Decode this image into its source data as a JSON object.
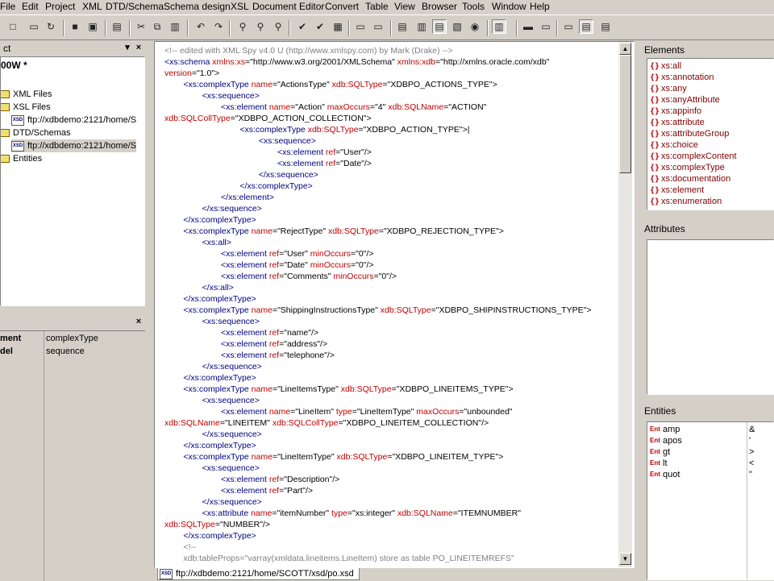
{
  "menu": [
    "File",
    "Edit",
    "Project",
    "XML",
    "DTD/Schema",
    "Schema design",
    "XSL",
    "Document Editor",
    "Convert",
    "Table",
    "View",
    "Browser",
    "Tools",
    "Window",
    "Help"
  ],
  "project_pane": {
    "title": "ct",
    "root": "00W *",
    "items": [
      {
        "label": "XML Files",
        "icon": "folder-icon"
      },
      {
        "label": "XSL Files",
        "icon": "folder-icon"
      },
      {
        "label": "ftp://xdbdemo:2121/home/S",
        "icon": "xsd-file-icon"
      },
      {
        "label": "DTD/Schemas",
        "icon": "folder-icon"
      },
      {
        "label": "ftp://xdbdemo:2121/home/S",
        "icon": "xsd-file-icon"
      },
      {
        "label": "Entities",
        "icon": "folder-icon"
      }
    ]
  },
  "info_pane": {
    "rows": [
      {
        "key": "ment",
        "value": "complexType"
      },
      {
        "key": "del",
        "value": "sequence"
      }
    ]
  },
  "editor": {
    "lines": [
      [
        [
          "cmt",
          "<!-- edited with XML Spy v4.0 U (http://www.xmlspy.com) by Mark (Drake) -->"
        ]
      ],
      [
        [
          "tag",
          "<xs:schema "
        ],
        [
          "att",
          "xmlns:xs"
        ],
        [
          "val",
          "=\"http://www.w3.org/2001/XMLSchema\" "
        ],
        [
          "att",
          "xmlns:xdb"
        ],
        [
          "val",
          "=\"http://xmlns.oracle.com/xdb\""
        ]
      ],
      [
        [
          "att",
          "version"
        ],
        [
          "val",
          "=\"1.0\">"
        ]
      ],
      [
        [
          "tag",
          "        <xs:complexType "
        ],
        [
          "att",
          "name"
        ],
        [
          "val",
          "=\"ActionsType\" "
        ],
        [
          "att",
          "xdb:SQLType"
        ],
        [
          "val",
          "=\"XDBPO_ACTIONS_TYPE\">"
        ]
      ],
      [
        [
          "tag",
          "                <xs:sequence>"
        ]
      ],
      [
        [
          "tag",
          "                        <xs:element "
        ],
        [
          "att",
          "name"
        ],
        [
          "val",
          "=\"Action\" "
        ],
        [
          "att",
          "maxOccurs"
        ],
        [
          "val",
          "=\"4\" "
        ],
        [
          "att",
          "xdb:SQLName"
        ],
        [
          "val",
          "=\"ACTION\""
        ]
      ],
      [
        [
          "att",
          "xdb:SQLCollType"
        ],
        [
          "val",
          "=\"XDBPO_ACTION_COLLECTION\">"
        ]
      ],
      [
        [
          "tag",
          "                                <xs:complexType "
        ],
        [
          "att",
          "xdb:SQLType"
        ],
        [
          "val",
          "=\"XDBPO_ACTION_TYPE\">|"
        ]
      ],
      [
        [
          "tag",
          "                                        <xs:sequence>"
        ]
      ],
      [
        [
          "tag",
          "                                                <xs:element "
        ],
        [
          "att",
          "ref"
        ],
        [
          "val",
          "=\"User\"/>"
        ]
      ],
      [
        [
          "tag",
          "                                                <xs:element "
        ],
        [
          "att",
          "ref"
        ],
        [
          "val",
          "=\"Date\"/>"
        ]
      ],
      [
        [
          "tag",
          "                                        </xs:sequence>"
        ]
      ],
      [
        [
          "tag",
          "                                </xs:complexType>"
        ]
      ],
      [
        [
          "tag",
          "                        </xs:element>"
        ]
      ],
      [
        [
          "tag",
          "                </xs:sequence>"
        ]
      ],
      [
        [
          "tag",
          "        </xs:complexType>"
        ]
      ],
      [
        [
          "tag",
          "        <xs:complexType "
        ],
        [
          "att",
          "name"
        ],
        [
          "val",
          "=\"RejectType\" "
        ],
        [
          "att",
          "xdb:SQLType"
        ],
        [
          "val",
          "=\"XDBPO_REJECTION_TYPE\">"
        ]
      ],
      [
        [
          "tag",
          "                <xs:all>"
        ]
      ],
      [
        [
          "tag",
          "                        <xs:element "
        ],
        [
          "att",
          "ref"
        ],
        [
          "val",
          "=\"User\" "
        ],
        [
          "att",
          "minOccurs"
        ],
        [
          "val",
          "=\"0\"/>"
        ]
      ],
      [
        [
          "tag",
          "                        <xs:element "
        ],
        [
          "att",
          "ref"
        ],
        [
          "val",
          "=\"Date\" "
        ],
        [
          "att",
          "minOccurs"
        ],
        [
          "val",
          "=\"0\"/>"
        ]
      ],
      [
        [
          "tag",
          "                        <xs:element "
        ],
        [
          "att",
          "ref"
        ],
        [
          "val",
          "=\"Comments\" "
        ],
        [
          "att",
          "minOccurs"
        ],
        [
          "val",
          "=\"0\"/>"
        ]
      ],
      [
        [
          "tag",
          "                </xs:all>"
        ]
      ],
      [
        [
          "tag",
          "        </xs:complexType>"
        ]
      ],
      [
        [
          "tag",
          "        <xs:complexType "
        ],
        [
          "att",
          "name"
        ],
        [
          "val",
          "=\"ShippingInstructionsType\" "
        ],
        [
          "att",
          "xdb:SQLType"
        ],
        [
          "val",
          "=\"XDBPO_SHIPINSTRUCTIONS_TYPE\">"
        ]
      ],
      [
        [
          "tag",
          "                <xs:sequence>"
        ]
      ],
      [
        [
          "tag",
          "                        <xs:element "
        ],
        [
          "att",
          "ref"
        ],
        [
          "val",
          "=\"name\"/>"
        ]
      ],
      [
        [
          "tag",
          "                        <xs:element "
        ],
        [
          "att",
          "ref"
        ],
        [
          "val",
          "=\"address\"/>"
        ]
      ],
      [
        [
          "tag",
          "                        <xs:element "
        ],
        [
          "att",
          "ref"
        ],
        [
          "val",
          "=\"telephone\"/>"
        ]
      ],
      [
        [
          "tag",
          "                </xs:sequence>"
        ]
      ],
      [
        [
          "tag",
          "        </xs:complexType>"
        ]
      ],
      [
        [
          "tag",
          "        <xs:complexType "
        ],
        [
          "att",
          "name"
        ],
        [
          "val",
          "=\"LineItemsType\" "
        ],
        [
          "att",
          "xdb:SQLType"
        ],
        [
          "val",
          "=\"XDBPO_LINEITEMS_TYPE\">"
        ]
      ],
      [
        [
          "tag",
          "                <xs:sequence>"
        ]
      ],
      [
        [
          "tag",
          "                        <xs:element "
        ],
        [
          "att",
          "name"
        ],
        [
          "val",
          "=\"LineItem\" "
        ],
        [
          "att",
          "type"
        ],
        [
          "val",
          "=\"LineItemType\" "
        ],
        [
          "att",
          "maxOccurs"
        ],
        [
          "val",
          "=\"unbounded\""
        ]
      ],
      [
        [
          "att",
          "xdb:SQLName"
        ],
        [
          "val",
          "=\"LINEITEM\" "
        ],
        [
          "att",
          "xdb:SQLCollType"
        ],
        [
          "val",
          "=\"XDBPO_LINEITEM_COLLECTION\"/>"
        ]
      ],
      [
        [
          "tag",
          "                </xs:sequence>"
        ]
      ],
      [
        [
          "tag",
          "        </xs:complexType>"
        ]
      ],
      [
        [
          "tag",
          "        <xs:complexType "
        ],
        [
          "att",
          "name"
        ],
        [
          "val",
          "=\"LineItemType\" "
        ],
        [
          "att",
          "xdb:SQLType"
        ],
        [
          "val",
          "=\"XDBPO_LINEITEM_TYPE\">"
        ]
      ],
      [
        [
          "tag",
          "                <xs:sequence>"
        ]
      ],
      [
        [
          "tag",
          "                        <xs:element "
        ],
        [
          "att",
          "ref"
        ],
        [
          "val",
          "=\"Description\"/>"
        ]
      ],
      [
        [
          "tag",
          "                        <xs:element "
        ],
        [
          "att",
          "ref"
        ],
        [
          "val",
          "=\"Part\"/>"
        ]
      ],
      [
        [
          "tag",
          "                </xs:sequence>"
        ]
      ],
      [
        [
          "tag",
          "                <xs:attribute "
        ],
        [
          "att",
          "name"
        ],
        [
          "val",
          "=\"itemNumber\" "
        ],
        [
          "att",
          "type"
        ],
        [
          "val",
          "=\"xs:integer\" "
        ],
        [
          "att",
          "xdb:SQLName"
        ],
        [
          "val",
          "=\"ITEMNUMBER\""
        ]
      ],
      [
        [
          "att",
          "xdb:SQLType"
        ],
        [
          "val",
          "=\"NUMBER\"/>"
        ]
      ],
      [
        [
          "tag",
          "        </xs:complexType>"
        ]
      ],
      [
        [
          "cmt",
          "        <!--"
        ]
      ],
      [
        [
          "cmt",
          "        xdb:tableProps=\"varray(xmldata.lineitems.LineItem) store as table PO_LINEITEMREFS\""
        ]
      ]
    ]
  },
  "file_tab": {
    "label": "ftp://xdbdemo:2121/home/SCOTT/xsd/po.xsd",
    "icon": "xsd-file-icon"
  },
  "elements_pane": {
    "title": "Elements",
    "items": [
      "xs:all",
      "xs:annotation",
      "xs:any",
      "xs:anyAttribute",
      "xs:appinfo",
      "xs:attribute",
      "xs:attributeGroup",
      "xs:choice",
      "xs:complexContent",
      "xs:complexType",
      "xs:documentation",
      "xs:element",
      "xs:enumeration"
    ]
  },
  "attributes_pane": {
    "title": "Attributes"
  },
  "entities_pane": {
    "title": "Entities",
    "items": [
      {
        "name": "amp",
        "value": "&"
      },
      {
        "name": "apos",
        "value": "'"
      },
      {
        "name": "gt",
        "value": ">"
      },
      {
        "name": "lt",
        "value": "<"
      },
      {
        "name": "quot",
        "value": "\""
      }
    ],
    "icon_label": "Ent"
  },
  "toolbar": {
    "icons": [
      "new-icon",
      "open-icon",
      "refresh-icon",
      "save-icon",
      "save-all-icon",
      "print-icon",
      "cut-icon",
      "copy-icon",
      "paste-icon",
      "undo-icon",
      "redo-icon",
      "find-icon",
      "find-next-icon",
      "replace-icon",
      "check-wellformed-icon",
      "validate-icon",
      "table-view-icon",
      "xsl-transform-icon",
      "fo-transform-icon",
      "enhanced-grid-icon",
      "schema-design-icon",
      "text-view-icon",
      "authentic-view-icon",
      "browser-view-icon",
      "project-window-icon",
      "info-window-icon",
      "entry-helper-icon",
      "output-icon",
      "wrap-icon",
      "word-wrap-icon"
    ]
  }
}
